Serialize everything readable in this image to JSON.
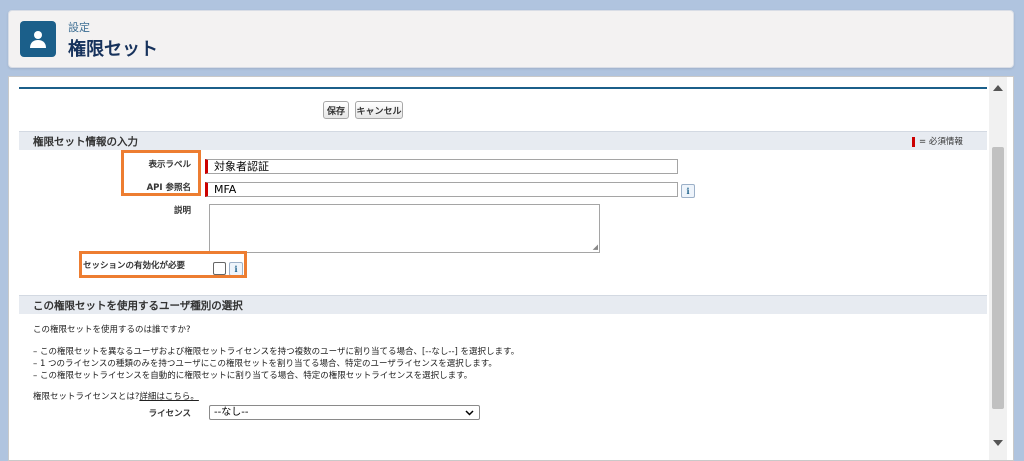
{
  "header": {
    "subtitle": "設定",
    "title": "権限セット",
    "icon": "user-icon"
  },
  "toolbar": {
    "save_label": "保存",
    "cancel_label": "キャンセル"
  },
  "section1": {
    "title": "権限セット情報の入力",
    "required_legend": "= 必須情報",
    "fields": {
      "display_label": {
        "label": "表示ラベル",
        "value": "対象者認証"
      },
      "api_name": {
        "label": "API 参照名",
        "value": "MFA"
      },
      "description": {
        "label": "説明",
        "value": ""
      },
      "session_activation": {
        "label": "セッションの有効化が必要",
        "checked": false
      }
    }
  },
  "section2": {
    "title": "この権限セットを使用するユーザ種別の選択",
    "question": "この権限セットを使用するのは誰ですか?",
    "bullets": [
      "– この権限セットを異なるユーザおよび権限セットライセンスを持つ複数のユーザに割り当てる場合、[--なし--] を選択します。",
      "– 1 つのライセンスの種類のみを持つユーザにこの権限セットを割り当てる場合、特定のユーザライセンスを選択します。",
      "– この権限セットライセンスを自動的に権限セットに割り当てる場合、特定の権限セットライセンスを選択します。"
    ],
    "license_help_prefix": "権限セットライセンスとは?",
    "license_help_link": "詳細はこちら。",
    "license_label": "ライセンス",
    "license_selected": "--なし--"
  },
  "colors": {
    "accent": "#1b5f8a",
    "required": "#cc0000",
    "highlight": "#ed7d31"
  }
}
